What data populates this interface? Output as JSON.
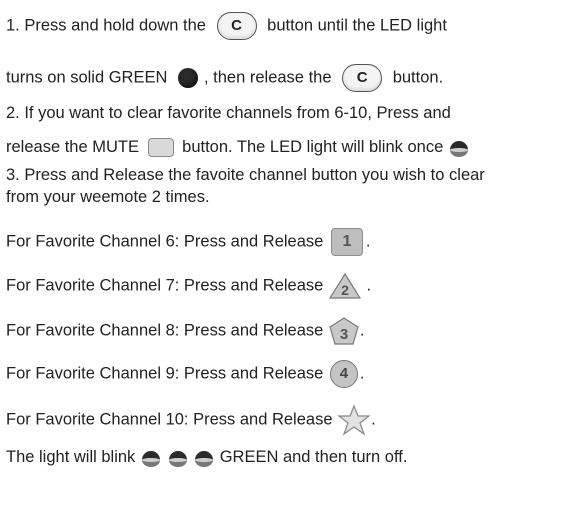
{
  "step1": {
    "line1_prefix": "1. Press and hold down the",
    "c_label": "C",
    "line1_suffix": "button  until the LED light",
    "line2_prefix": "turns on solid GREEN",
    "line2_middle": ", then release the",
    "line2_suffix": "button."
  },
  "step2": {
    "line1": "2.  If you want to clear favorite channels from 6-10, Press and",
    "line2_prefix": "release the MUTE",
    "line2_suffix": "button. The LED light will blink once"
  },
  "step3": {
    "line1": "3. Press and Release the favoite channel button you wish to clear",
    "line2": "from your weemote 2 times."
  },
  "favorites": [
    {
      "text": "For Favorite Channel 6: Press and Release",
      "button_label": "1",
      "shape": "square"
    },
    {
      "text": "For Favorite Channel 7: Press and Release",
      "button_label": "2",
      "shape": "triangle"
    },
    {
      "text": "For Favorite Channel 8: Press and Release",
      "button_label": "3",
      "shape": "pentagon"
    },
    {
      "text": "For Favorite Channel 9: Press and Release",
      "button_label": "4",
      "shape": "circle"
    },
    {
      "text": "For Favorite Channel 10: Press and Release",
      "button_label": "",
      "shape": "star"
    }
  ],
  "final": {
    "prefix": "The light will  blink",
    "suffix": "GREEN and then turn off."
  },
  "icons": {
    "c_button": "c-button-icon",
    "led": "led-icon",
    "mute": "mute-button-icon",
    "blink": "blink-led-icon"
  },
  "colors": {
    "text": "#222222",
    "led": "#2a2a2a",
    "button_gray": "#bdbdbd"
  }
}
